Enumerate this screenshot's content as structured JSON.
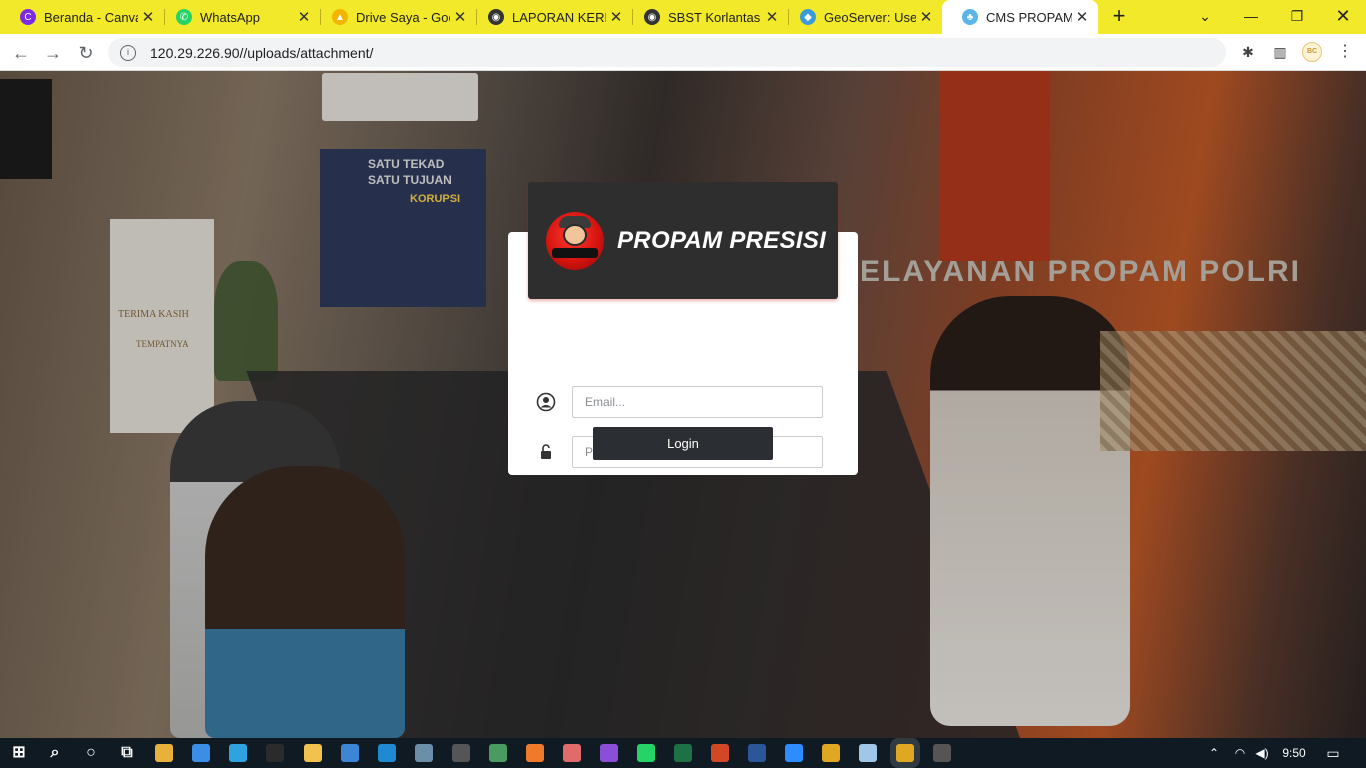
{
  "browser": {
    "tabs": [
      {
        "title": "Beranda - Canva",
        "icon": "canva-icon",
        "color": "#7d2ae8",
        "glyph": "C"
      },
      {
        "title": "WhatsApp",
        "icon": "whatsapp-icon",
        "color": "#25d366",
        "glyph": "✆"
      },
      {
        "title": "Drive Saya - Goo",
        "icon": "google-drive-icon",
        "color": "#f4b400",
        "glyph": "▲"
      },
      {
        "title": "LAPORAN KEREN",
        "icon": "globe-icon",
        "color": "#333333",
        "glyph": "◉"
      },
      {
        "title": "SBST Korlantas Po",
        "icon": "globe-icon",
        "color": "#333333",
        "glyph": "◉"
      },
      {
        "title": "GeoServer: User I",
        "icon": "geoserver-icon",
        "color": "#3a9bd8",
        "glyph": "◆"
      },
      {
        "title": "CMS PROPAM",
        "icon": "cms-icon",
        "color": "#5ab6e8",
        "glyph": "♣",
        "active": true
      }
    ],
    "new_tab": "+",
    "url": "120.29.226.90//uploads/attachment/",
    "profile_label": "BC"
  },
  "login": {
    "brand": "PROPAM PRESISI",
    "email_placeholder": "Email...",
    "password_placeholder": "Password...",
    "login_label": "Login"
  },
  "background_signage": {
    "banner_top": "SATU TEKAD",
    "banner_mid": "SATU TUJUAN",
    "banner_bottom": "KORUPSI",
    "wall_text": "PELAYANAN PROPAM POLRI",
    "standee_title": "TERIMA KASIH",
    "standee_bottom": "TEMPATNYA"
  },
  "taskbar": {
    "clock": "9:50",
    "apps": [
      {
        "name": "start-icon"
      },
      {
        "name": "search-icon"
      },
      {
        "name": "cortana-icon"
      },
      {
        "name": "task-view-icon"
      },
      {
        "name": "store-icon",
        "color": "#e8b23a"
      },
      {
        "name": "mail-icon",
        "color": "#3a8ee6"
      },
      {
        "name": "edge-icon",
        "color": "#2fa3e0"
      },
      {
        "name": "terminal-icon",
        "color": "#2b2b2b"
      },
      {
        "name": "file-explorer-icon",
        "color": "#f2c14e"
      },
      {
        "name": "control-panel-icon",
        "color": "#3d86d6"
      },
      {
        "name": "vscode-icon",
        "color": "#1f8ad2"
      },
      {
        "name": "photos-icon",
        "color": "#6b8fa8"
      },
      {
        "name": "calculator-icon",
        "color": "#555555"
      },
      {
        "name": "paint-icon",
        "color": "#4a9b5f"
      },
      {
        "name": "xampp-icon",
        "color": "#f07a2a"
      },
      {
        "name": "snipping-icon",
        "color": "#e06b6b"
      },
      {
        "name": "visual-studio-icon",
        "color": "#8a4fd6"
      },
      {
        "name": "whatsapp-icon",
        "color": "#25d366"
      },
      {
        "name": "excel-icon",
        "color": "#1e7145"
      },
      {
        "name": "powerpoint-icon",
        "color": "#d24726"
      },
      {
        "name": "word-icon",
        "color": "#2b579a"
      },
      {
        "name": "zoom-icon",
        "color": "#2d8cff"
      },
      {
        "name": "chrome-icon",
        "color": "#e0a822"
      },
      {
        "name": "notepad-icon",
        "color": "#9fc7e8"
      },
      {
        "name": "chrome-icon-active",
        "color": "#e0a822"
      },
      {
        "name": "pen-icon",
        "color": "#555555"
      }
    ]
  }
}
